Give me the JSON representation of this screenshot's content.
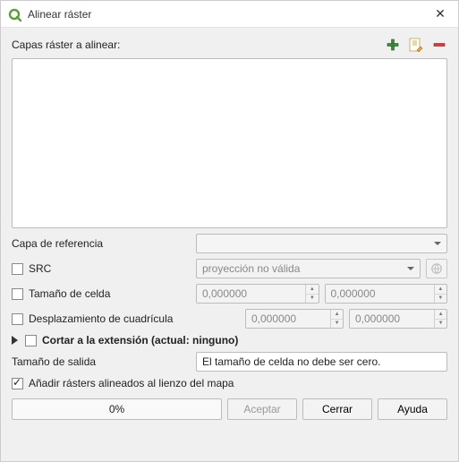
{
  "window": {
    "title": "Alinear ráster"
  },
  "layers": {
    "label": "Capas ráster a alinear:"
  },
  "reference": {
    "label": "Capa de referencia"
  },
  "src": {
    "label": "SRC",
    "value": "proyección no válida"
  },
  "cell": {
    "label": "Tamaño de celda",
    "x": "0,000000",
    "y": "0,000000"
  },
  "offset": {
    "label": "Desplazamiento de cuadrícula",
    "x": "0,000000",
    "y": "0,000000"
  },
  "clip": {
    "label": "Cortar a la extensión (actual: ninguno)"
  },
  "outputSize": {
    "label": "Tamaño de salida",
    "value": "El tamaño de celda no debe ser cero."
  },
  "addToMap": {
    "label": "Añadir rásters alineados al lienzo del mapa"
  },
  "progress": {
    "text": "0%"
  },
  "buttons": {
    "accept": "Aceptar",
    "close": "Cerrar",
    "help": "Ayuda"
  }
}
